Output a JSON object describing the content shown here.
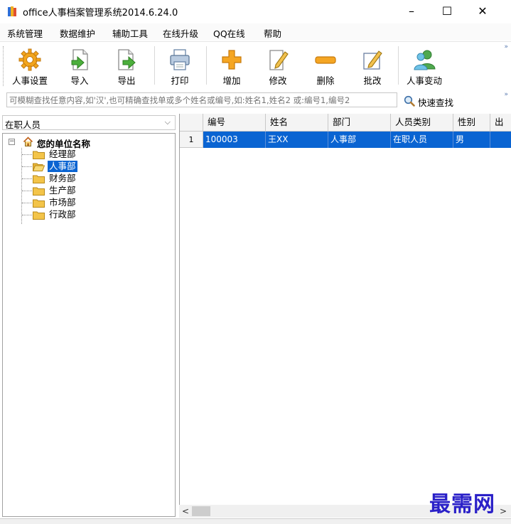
{
  "window": {
    "title": "office人事档案管理系统2014.6.24.0",
    "minimize": "–",
    "maximize": "☐",
    "close": "✕"
  },
  "menu": [
    "系统管理",
    "数据维护",
    "辅助工具",
    "在线升级",
    "QQ在线",
    "帮助"
  ],
  "toolbar": {
    "buttons": [
      {
        "label": "人事设置",
        "icon": "gear-icon"
      },
      {
        "label": "导入",
        "icon": "import-icon"
      },
      {
        "label": "导出",
        "icon": "export-icon"
      },
      {
        "label": "打印",
        "icon": "printer-icon"
      },
      {
        "label": "增加",
        "icon": "plus-icon"
      },
      {
        "label": "修改",
        "icon": "edit-icon"
      },
      {
        "label": "删除",
        "icon": "minus-icon"
      },
      {
        "label": "批改",
        "icon": "batch-edit-icon"
      },
      {
        "label": "人事变动",
        "icon": "people-icon"
      }
    ],
    "overflow": "»"
  },
  "search": {
    "placeholder": "可模糊查找任意内容,如'汉',也可精确查找单或多个姓名或编号,如:姓名1,姓名2 或:编号1,编号2",
    "button_label": "快速查找",
    "overflow": "»"
  },
  "filter": {
    "selected": "在职人员"
  },
  "tree": {
    "root": "您的单位名称",
    "expander": "−",
    "nodes": [
      "经理部",
      "人事部",
      "财务部",
      "生产部",
      "市场部",
      "行政部"
    ],
    "selected_index": 1
  },
  "grid": {
    "columns": [
      "编号",
      "姓名",
      "部门",
      "人员类别",
      "性别",
      "出"
    ],
    "rows": [
      {
        "num": "1",
        "cells": [
          "100003",
          "王XX",
          "人事部",
          "在职人员",
          "男",
          ""
        ]
      }
    ]
  },
  "scrollbar": {
    "left": "<",
    "right": ">"
  },
  "watermark": "最需网",
  "colors": {
    "selection": "#0a64d2",
    "watermark": "#2a20c8"
  }
}
